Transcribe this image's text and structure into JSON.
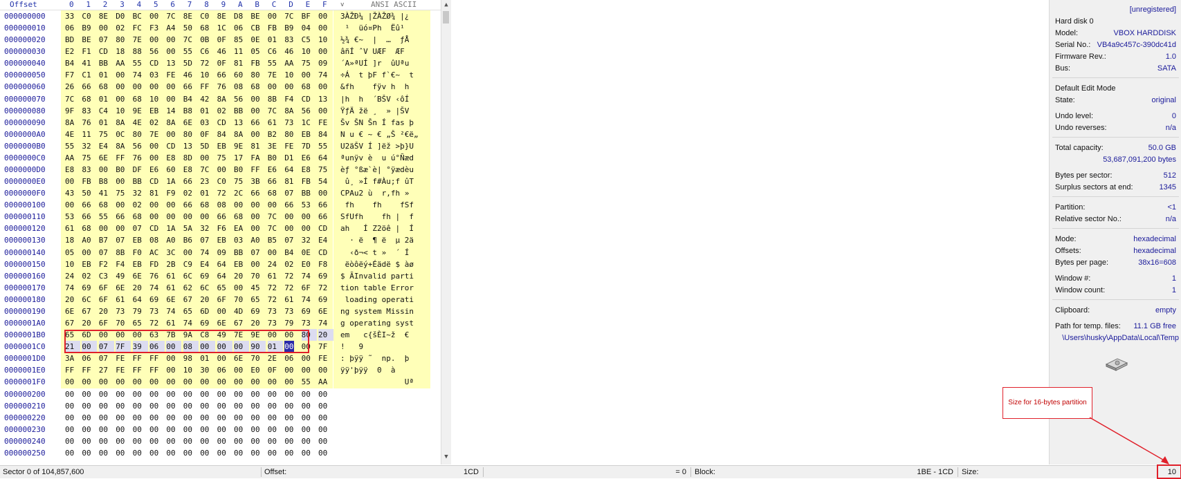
{
  "header": {
    "offset_label": "Offset",
    "columns": [
      "0",
      "1",
      "2",
      "3",
      "4",
      "5",
      "6",
      "7",
      "8",
      "9",
      "A",
      "B",
      "C",
      "D",
      "E",
      "F"
    ],
    "text_tab_arrow": "v",
    "text_label": "ANSI ASCII"
  },
  "rows": [
    {
      "offset": "000000000",
      "hex": [
        "33",
        "C0",
        "8E",
        "D0",
        "BC",
        "00",
        "7C",
        "8E",
        "C0",
        "8E",
        "D8",
        "BE",
        "00",
        "7C",
        "BF",
        "00"
      ],
      "ascii": "3ÀŽÐ¼ |ŽÀŽØ¾ |¿"
    },
    {
      "offset": "000000010",
      "hex": [
        "06",
        "B9",
        "00",
        "02",
        "FC",
        "F3",
        "A4",
        "50",
        "68",
        "1C",
        "06",
        "CB",
        "FB",
        "B9",
        "04",
        "00"
      ],
      "ascii": " ¹  üó¤Ph  Ëû¹"
    },
    {
      "offset": "000000020",
      "hex": [
        "BD",
        "BE",
        "07",
        "80",
        "7E",
        "00",
        "00",
        "7C",
        "0B",
        "0F",
        "85",
        "0E",
        "01",
        "83",
        "C5",
        "10"
      ],
      "ascii": "½¾ €~  |  …  ƒÅ"
    },
    {
      "offset": "000000030",
      "hex": [
        "E2",
        "F1",
        "CD",
        "18",
        "88",
        "56",
        "00",
        "55",
        "C6",
        "46",
        "11",
        "05",
        "C6",
        "46",
        "10",
        "00"
      ],
      "ascii": "âñÍ ˆV UÆF  ÆF"
    },
    {
      "offset": "000000040",
      "hex": [
        "B4",
        "41",
        "BB",
        "AA",
        "55",
        "CD",
        "13",
        "5D",
        "72",
        "0F",
        "81",
        "FB",
        "55",
        "AA",
        "75",
        "09"
      ],
      "ascii": "´A»ªUÍ ]r  ûUªu"
    },
    {
      "offset": "000000050",
      "hex": [
        "F7",
        "C1",
        "01",
        "00",
        "74",
        "03",
        "FE",
        "46",
        "10",
        "66",
        "60",
        "80",
        "7E",
        "10",
        "00",
        "74"
      ],
      "ascii": "÷Á  t þF f`€~  t"
    },
    {
      "offset": "000000060",
      "hex": [
        "26",
        "66",
        "68",
        "00",
        "00",
        "00",
        "00",
        "66",
        "FF",
        "76",
        "08",
        "68",
        "00",
        "00",
        "68",
        "00"
      ],
      "ascii": "&fh    fÿv h  h"
    },
    {
      "offset": "000000070",
      "hex": [
        "7C",
        "68",
        "01",
        "00",
        "68",
        "10",
        "00",
        "B4",
        "42",
        "8A",
        "56",
        "00",
        "8B",
        "F4",
        "CD",
        "13"
      ],
      "ascii": "|h  h  ´BŠV ‹ôÍ"
    },
    {
      "offset": "000000080",
      "hex": [
        "9F",
        "83",
        "C4",
        "10",
        "9E",
        "EB",
        "14",
        "B8",
        "01",
        "02",
        "BB",
        "00",
        "7C",
        "8A",
        "56",
        "00"
      ],
      "ascii": "ŸƒÄ žë ¸  » |ŠV"
    },
    {
      "offset": "000000090",
      "hex": [
        "8A",
        "76",
        "01",
        "8A",
        "4E",
        "02",
        "8A",
        "6E",
        "03",
        "CD",
        "13",
        "66",
        "61",
        "73",
        "1C",
        "FE"
      ],
      "ascii": "Šv ŠN Šn Í fas þ"
    },
    {
      "offset": "0000000A0",
      "hex": [
        "4E",
        "11",
        "75",
        "0C",
        "80",
        "7E",
        "00",
        "80",
        "0F",
        "84",
        "8A",
        "00",
        "B2",
        "80",
        "EB",
        "84"
      ],
      "ascii": "N u € ~ € „Š ²€ë„"
    },
    {
      "offset": "0000000B0",
      "hex": [
        "55",
        "32",
        "E4",
        "8A",
        "56",
        "00",
        "CD",
        "13",
        "5D",
        "EB",
        "9E",
        "81",
        "3E",
        "FE",
        "7D",
        "55"
      ],
      "ascii": "U2äŠV Í ]ëž >þ}U"
    },
    {
      "offset": "0000000C0",
      "hex": [
        "AA",
        "75",
        "6E",
        "FF",
        "76",
        "00",
        "E8",
        "8D",
        "00",
        "75",
        "17",
        "FA",
        "B0",
        "D1",
        "E6",
        "64"
      ],
      "ascii": "ªunÿv è  u ú°Ñæd"
    },
    {
      "offset": "0000000D0",
      "hex": [
        "E8",
        "83",
        "00",
        "B0",
        "DF",
        "E6",
        "60",
        "E8",
        "7C",
        "00",
        "B0",
        "FF",
        "E6",
        "64",
        "E8",
        "75"
      ],
      "ascii": "èƒ °ßæ`è| °ÿædèu"
    },
    {
      "offset": "0000000E0",
      "hex": [
        "00",
        "FB",
        "B8",
        "00",
        "BB",
        "CD",
        "1A",
        "66",
        "23",
        "C0",
        "75",
        "3B",
        "66",
        "81",
        "FB",
        "54"
      ],
      "ascii": " û¸ »Í f#Àu;f ûT"
    },
    {
      "offset": "0000000F0",
      "hex": [
        "43",
        "50",
        "41",
        "75",
        "32",
        "81",
        "F9",
        "02",
        "01",
        "72",
        "2C",
        "66",
        "68",
        "07",
        "BB",
        "00"
      ],
      "ascii": "CPAu2 ù  r,fh »"
    },
    {
      "offset": "000000100",
      "hex": [
        "00",
        "66",
        "68",
        "00",
        "02",
        "00",
        "00",
        "66",
        "68",
        "08",
        "00",
        "00",
        "00",
        "66",
        "53",
        "66"
      ],
      "ascii": " fh    fh    fSf"
    },
    {
      "offset": "000000110",
      "hex": [
        "53",
        "66",
        "55",
        "66",
        "68",
        "00",
        "00",
        "00",
        "00",
        "66",
        "68",
        "00",
        "7C",
        "00",
        "00",
        "66"
      ],
      "ascii": "SfUfh    fh |  f"
    },
    {
      "offset": "000000120",
      "hex": [
        "61",
        "68",
        "00",
        "00",
        "07",
        "CD",
        "1A",
        "5A",
        "32",
        "F6",
        "EA",
        "00",
        "7C",
        "00",
        "00",
        "CD"
      ],
      "ascii": "ah   Í Z2öê |  Í"
    },
    {
      "offset": "000000130",
      "hex": [
        "18",
        "A0",
        "B7",
        "07",
        "EB",
        "08",
        "A0",
        "B6",
        "07",
        "EB",
        "03",
        "A0",
        "B5",
        "07",
        "32",
        "E4"
      ],
      "ascii": "  · ë  ¶ ë  µ 2ä"
    },
    {
      "offset": "000000140",
      "hex": [
        "05",
        "00",
        "07",
        "8B",
        "F0",
        "AC",
        "3C",
        "00",
        "74",
        "09",
        "BB",
        "07",
        "00",
        "B4",
        "0E",
        "CD"
      ],
      "ascii": "  ‹ð¬< t »  ´ Í"
    },
    {
      "offset": "000000150",
      "hex": [
        "10",
        "EB",
        "F2",
        "F4",
        "EB",
        "FD",
        "2B",
        "C9",
        "E4",
        "64",
        "EB",
        "00",
        "24",
        "02",
        "E0",
        "F8"
      ],
      "ascii": " ëòôëý+Éädë $ àø"
    },
    {
      "offset": "000000160",
      "hex": [
        "24",
        "02",
        "C3",
        "49",
        "6E",
        "76",
        "61",
        "6C",
        "69",
        "64",
        "20",
        "70",
        "61",
        "72",
        "74",
        "69"
      ],
      "ascii": "$ ÃInvalid parti"
    },
    {
      "offset": "000000170",
      "hex": [
        "74",
        "69",
        "6F",
        "6E",
        "20",
        "74",
        "61",
        "62",
        "6C",
        "65",
        "00",
        "45",
        "72",
        "72",
        "6F",
        "72"
      ],
      "ascii": "tion table Error"
    },
    {
      "offset": "000000180",
      "hex": [
        "20",
        "6C",
        "6F",
        "61",
        "64",
        "69",
        "6E",
        "67",
        "20",
        "6F",
        "70",
        "65",
        "72",
        "61",
        "74",
        "69"
      ],
      "ascii": " loading operati"
    },
    {
      "offset": "000000190",
      "hex": [
        "6E",
        "67",
        "20",
        "73",
        "79",
        "73",
        "74",
        "65",
        "6D",
        "00",
        "4D",
        "69",
        "73",
        "73",
        "69",
        "6E"
      ],
      "ascii": "ng system Missin"
    },
    {
      "offset": "0000001A0",
      "hex": [
        "67",
        "20",
        "6F",
        "70",
        "65",
        "72",
        "61",
        "74",
        "69",
        "6E",
        "67",
        "20",
        "73",
        "79",
        "73",
        "74"
      ],
      "ascii": "g operating syst"
    },
    {
      "offset": "0000001B0",
      "hex": [
        "65",
        "6D",
        "00",
        "00",
        "00",
        "63",
        "7B",
        "9A",
        "C8",
        "49",
        "7E",
        "9E",
        "00",
        "00",
        "80",
        "20"
      ],
      "ascii": "em   c{šÈI~ž  €"
    },
    {
      "offset": "0000001C0",
      "hex": [
        "21",
        "00",
        "07",
        "7F",
        "39",
        "06",
        "00",
        "08",
        "00",
        "00",
        "00",
        "90",
        "01",
        "00",
        "00",
        "7F"
      ],
      "ascii": "!   9"
    },
    {
      "offset": "0000001D0",
      "hex": [
        "3A",
        "06",
        "07",
        "FE",
        "FF",
        "FF",
        "00",
        "98",
        "01",
        "00",
        "6E",
        "70",
        "2E",
        "06",
        "00",
        "FE"
      ],
      "ascii": ": þÿÿ ˜  np.  þ"
    },
    {
      "offset": "0000001E0",
      "hex": [
        "FF",
        "FF",
        "27",
        "FE",
        "FF",
        "FF",
        "00",
        "10",
        "30",
        "06",
        "00",
        "E0",
        "0F",
        "00",
        "00",
        "00"
      ],
      "ascii": "ÿÿ'þÿÿ  0  à"
    },
    {
      "offset": "0000001F0",
      "hex": [
        "00",
        "00",
        "00",
        "00",
        "00",
        "00",
        "00",
        "00",
        "00",
        "00",
        "00",
        "00",
        "00",
        "00",
        "55",
        "AA"
      ],
      "ascii": "              Uª"
    },
    {
      "offset": "000000200",
      "hex": [
        "00",
        "00",
        "00",
        "00",
        "00",
        "00",
        "00",
        "00",
        "00",
        "00",
        "00",
        "00",
        "00",
        "00",
        "00",
        "00"
      ],
      "ascii": ""
    },
    {
      "offset": "000000210",
      "hex": [
        "00",
        "00",
        "00",
        "00",
        "00",
        "00",
        "00",
        "00",
        "00",
        "00",
        "00",
        "00",
        "00",
        "00",
        "00",
        "00"
      ],
      "ascii": ""
    },
    {
      "offset": "000000220",
      "hex": [
        "00",
        "00",
        "00",
        "00",
        "00",
        "00",
        "00",
        "00",
        "00",
        "00",
        "00",
        "00",
        "00",
        "00",
        "00",
        "00"
      ],
      "ascii": ""
    },
    {
      "offset": "000000230",
      "hex": [
        "00",
        "00",
        "00",
        "00",
        "00",
        "00",
        "00",
        "00",
        "00",
        "00",
        "00",
        "00",
        "00",
        "00",
        "00",
        "00"
      ],
      "ascii": ""
    },
    {
      "offset": "000000240",
      "hex": [
        "00",
        "00",
        "00",
        "00",
        "00",
        "00",
        "00",
        "00",
        "00",
        "00",
        "00",
        "00",
        "00",
        "00",
        "00",
        "00"
      ],
      "ascii": ""
    },
    {
      "offset": "000000250",
      "hex": [
        "00",
        "00",
        "00",
        "00",
        "00",
        "00",
        "00",
        "00",
        "00",
        "00",
        "00",
        "00",
        "00",
        "00",
        "00",
        "00"
      ],
      "ascii": ""
    }
  ],
  "panel": {
    "registration": "[unregistered]",
    "disk_title": "Hard disk 0",
    "model_label": "Model:",
    "model_value": "VBOX HARDDISK",
    "serial_label": "Serial No.:",
    "serial_value": "VB4a9c457c-390dc41d",
    "firmware_label": "Firmware Rev.:",
    "firmware_value": "1.0",
    "bus_label": "Bus:",
    "bus_value": "SATA",
    "edit_mode_title": "Default Edit Mode",
    "state_label": "State:",
    "state_value": "original",
    "undo_level_label": "Undo level:",
    "undo_level_value": "0",
    "undo_reverses_label": "Undo reverses:",
    "undo_reverses_value": "n/a",
    "total_capacity_label": "Total capacity:",
    "total_capacity_value": "50.0 GB",
    "total_bytes_value": "53,687,091,200 bytes",
    "bytes_per_sector_label": "Bytes per sector:",
    "bytes_per_sector_value": "512",
    "surplus_label": "Surplus sectors at end:",
    "surplus_value": "1345",
    "partition_label": "Partition:",
    "partition_value": "<1",
    "relative_sector_label": "Relative sector No.:",
    "relative_sector_value": "n/a",
    "mode_label": "Mode:",
    "mode_value": "hexadecimal",
    "offsets_label": "Offsets:",
    "offsets_value": "hexadecimal",
    "bytes_per_page_label": "Bytes per page:",
    "bytes_per_page_value": "38x16=608",
    "window_num_label": "Window #:",
    "window_num_value": "1",
    "window_count_label": "Window count:",
    "window_count_value": "1",
    "clipboard_label": "Clipboard:",
    "clipboard_value": "empty",
    "temp_path_label": "Path for temp. files:",
    "temp_path_value": "11.1 GB free",
    "temp_path": "\\Users\\husky\\AppData\\Local\\Temp"
  },
  "annotation": {
    "note": "Size for 16-bytes partition",
    "color": "#e0202a"
  },
  "statusbar": {
    "sector": "Sector 0 of 104,857,600",
    "offset_label": "Offset:",
    "offset_value": "1CD",
    "equals_value": "= 0",
    "block_label": "Block:",
    "block_value": "1BE - 1CD",
    "size_label": "Size:",
    "size_value": "10"
  },
  "colors": {
    "accent": "#1a1a9a",
    "highlight": "#ffffb8",
    "selection": "#2a2aa8"
  }
}
